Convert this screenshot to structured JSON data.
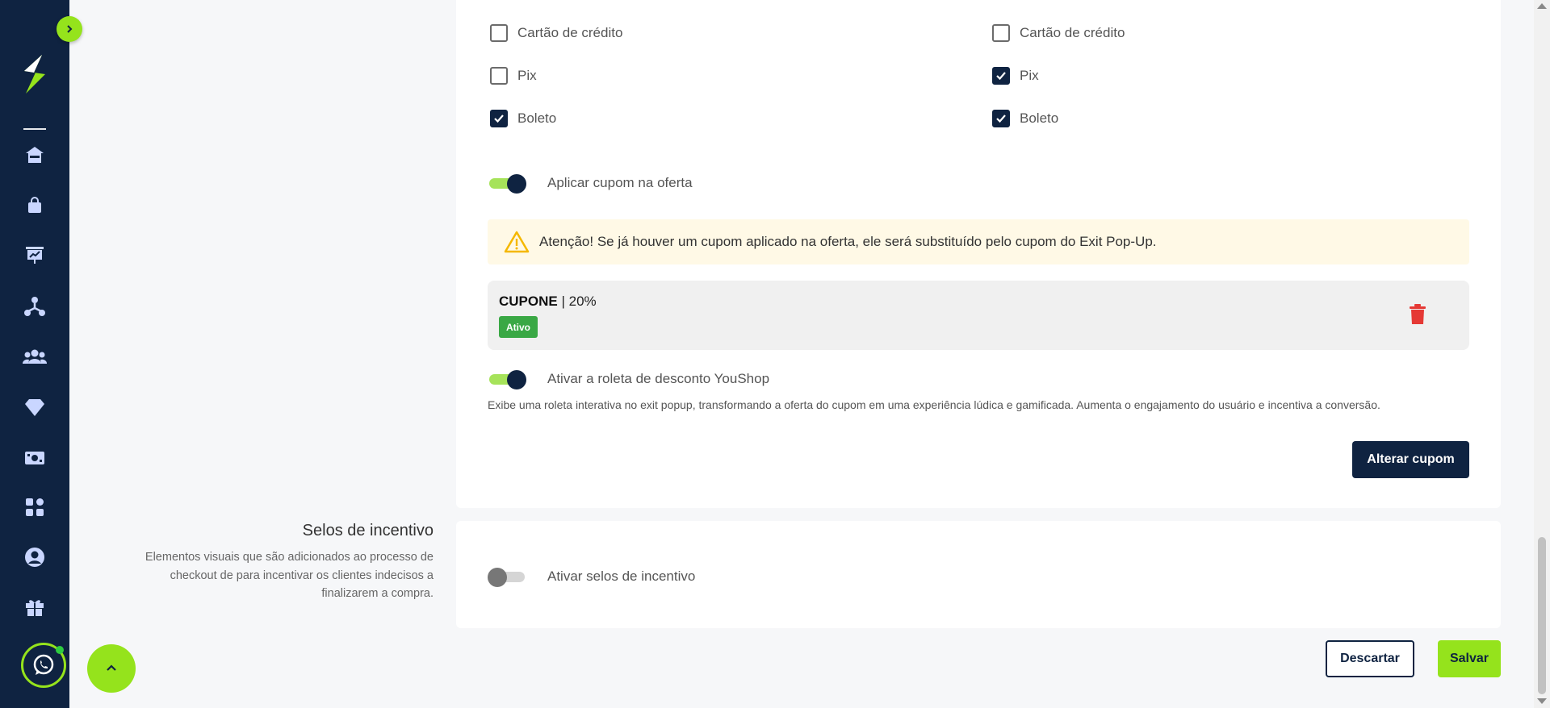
{
  "payment_methods": {
    "left": [
      {
        "label": "Cartão de crédito",
        "checked": false
      },
      {
        "label": "Pix",
        "checked": false
      },
      {
        "label": "Boleto",
        "checked": true
      }
    ],
    "right": [
      {
        "label": "Cartão de crédito",
        "checked": false
      },
      {
        "label": "Pix",
        "checked": true
      },
      {
        "label": "Boleto",
        "checked": true
      }
    ]
  },
  "coupon_toggle": {
    "label": "Aplicar cupom na oferta",
    "on": true
  },
  "alert": {
    "text": "Atenção! Se já houver um cupom aplicado na oferta, ele será substituído pelo cupom do Exit Pop-Up."
  },
  "coupon": {
    "code": "CUPONE",
    "separator": "|",
    "discount": "20%",
    "status": "Ativo"
  },
  "wheel_toggle": {
    "label": "Ativar a roleta de desconto YouShop",
    "on": true,
    "description": "Exibe uma roleta interativa no exit popup, transformando a oferta do cupom em uma experiência lúdica e gamificada. Aumenta o engajamento do usuário e incentiva a conversão."
  },
  "change_coupon_label": "Alterar cupom",
  "incentive": {
    "title": "Selos de incentivo",
    "description": "Elementos visuais que são adicionados ao processo de checkout de para incentivar os clientes indecisos a finalizarem a compra.",
    "toggle_label": "Ativar selos de incentivo",
    "on": false
  },
  "actions": {
    "discard_label": "Descartar",
    "save_label": "Salvar"
  },
  "colors": {
    "navy": "#0f2341",
    "accent": "#95e31c",
    "danger": "#e53935",
    "badge_green": "#3aa845"
  },
  "sidebar_icons": [
    "home-icon",
    "shopping-bag-icon",
    "presentation-chart-icon",
    "network-icon",
    "users-icon",
    "diamond-icon",
    "money-icon",
    "apps-icon",
    "user-circle-icon",
    "gift-icon"
  ]
}
